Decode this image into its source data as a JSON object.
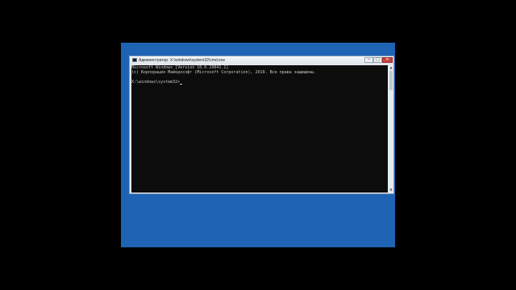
{
  "window": {
    "title": "Администратор: X:\\windows\\system32\\cmd.exe",
    "buttons": {
      "minimize": "─",
      "maximize": "□",
      "close": "✕"
    }
  },
  "console": {
    "lines": [
      "Microsoft Windows [Version 10.0.19041.1]",
      "(c) Корпорация Майкрософт (Microsoft Corporation), 2019. Все права защищены.",
      "",
      "X:\\windows\\system32>"
    ]
  },
  "scrollbar": {
    "up": "▲",
    "down": "▼"
  },
  "colors": {
    "desktop": "#1f64b4",
    "console_bg": "#0c0c0c",
    "console_text": "#c8c8c8",
    "close_button": "#c9423b"
  }
}
